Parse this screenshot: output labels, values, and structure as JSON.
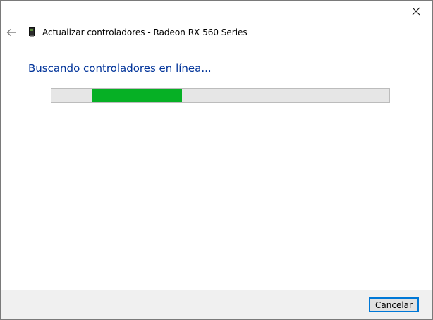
{
  "window": {
    "title": "Actualizar controladores - Radeon RX 560 Series",
    "close_icon": "close-icon",
    "back_icon": "back-arrow-icon",
    "device_icon": "graphics-card-icon"
  },
  "main": {
    "heading": "Buscando controladores en línea...",
    "progress": {
      "state": "indeterminate",
      "color": "#06b025"
    }
  },
  "footer": {
    "cancel_label": "Cancelar"
  },
  "colors": {
    "heading": "#003399",
    "accent": "#0078d7",
    "progress": "#06b025"
  }
}
